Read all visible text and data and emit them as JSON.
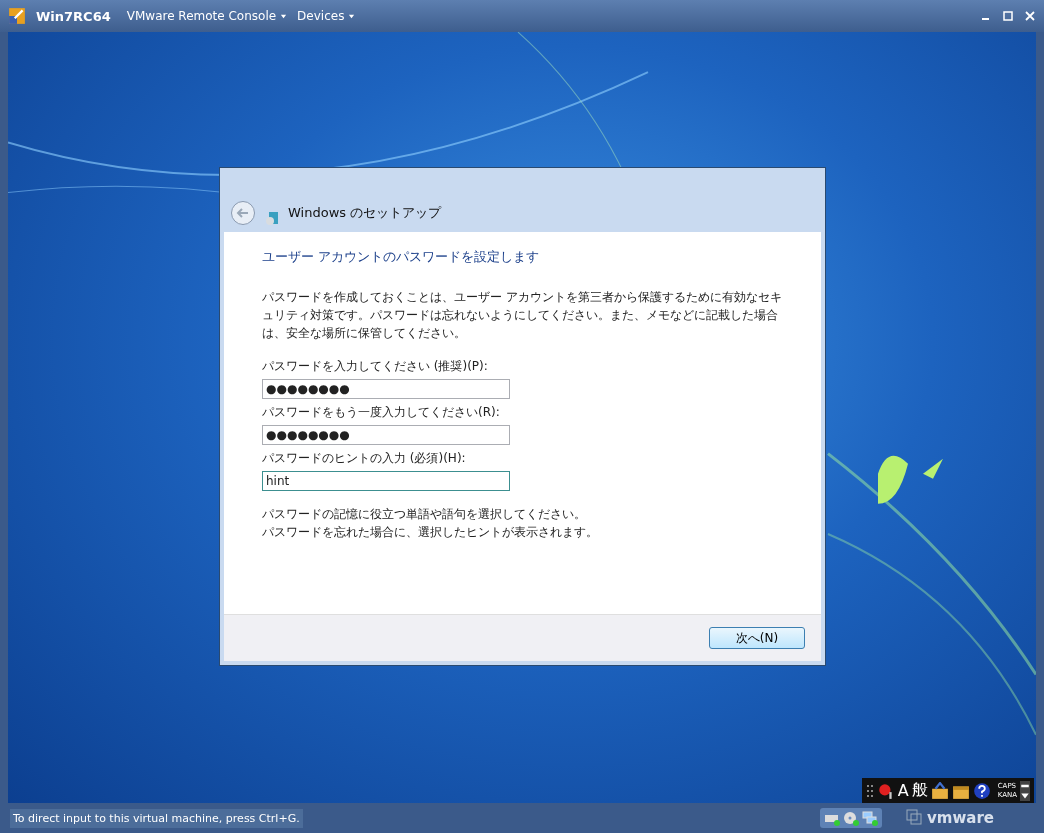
{
  "window": {
    "title": "Win7RC64",
    "menus": [
      "VMware Remote Console",
      "Devices"
    ]
  },
  "dialog": {
    "title": "Windows のセットアップ",
    "heading": "ユーザー アカウントのパスワードを設定します",
    "description": "パスワードを作成しておくことは、ユーザー アカウントを第三者から保護するために有効なセキュリティ対策です。パスワードは忘れないようにしてください。また、メモなどに記載した場合は、安全な場所に保管してください。",
    "fields": [
      {
        "label": "パスワードを入力してください (推奨)(P):",
        "value": "●●●●●●●●",
        "focused": false
      },
      {
        "label": "パスワードをもう一度入力してください(R):",
        "value": "●●●●●●●●",
        "focused": false
      },
      {
        "label": "パスワードのヒントの入力 (必須)(H):",
        "value": "hint",
        "focused": true
      }
    ],
    "notes": [
      "パスワードの記憶に役立つ単語や語句を選択してください。",
      "パスワードを忘れた場合に、選択したヒントが表示されます。"
    ],
    "next_button": "次へ(N)"
  },
  "language_bar": {
    "mode": "A",
    "ime": "般",
    "caps": "CAPS",
    "kana": "KANA"
  },
  "status_bar": {
    "message": "To direct input to this virtual machine, press Ctrl+G.",
    "logo": "vmware"
  }
}
